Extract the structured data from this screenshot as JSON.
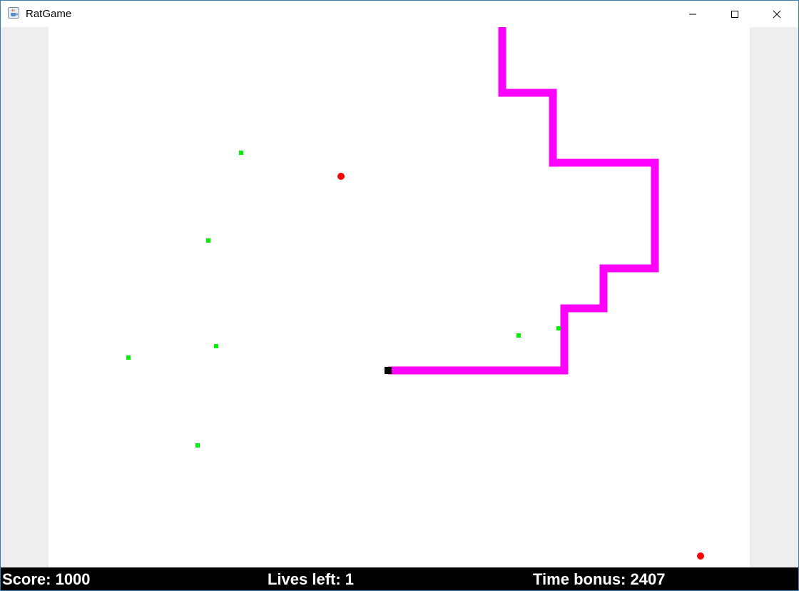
{
  "window": {
    "title": "RatGame",
    "app_icon": "java-coffee-icon",
    "controls": {
      "minimize_icon": "minimize-icon",
      "maximize_icon": "maximize-icon",
      "close_icon": "close-icon"
    }
  },
  "status": {
    "score": "Score: 1000",
    "lives": "Lives left: 1",
    "time_bonus": "Time bonus: 2407"
  },
  "colors": {
    "snake": "#ff00ff",
    "head": "#000000",
    "pellet": "#00ee00",
    "hazard": "#ff0000",
    "board_bg": "#ffffff",
    "status_bg": "#000000",
    "status_text": "#ffffff"
  }
}
